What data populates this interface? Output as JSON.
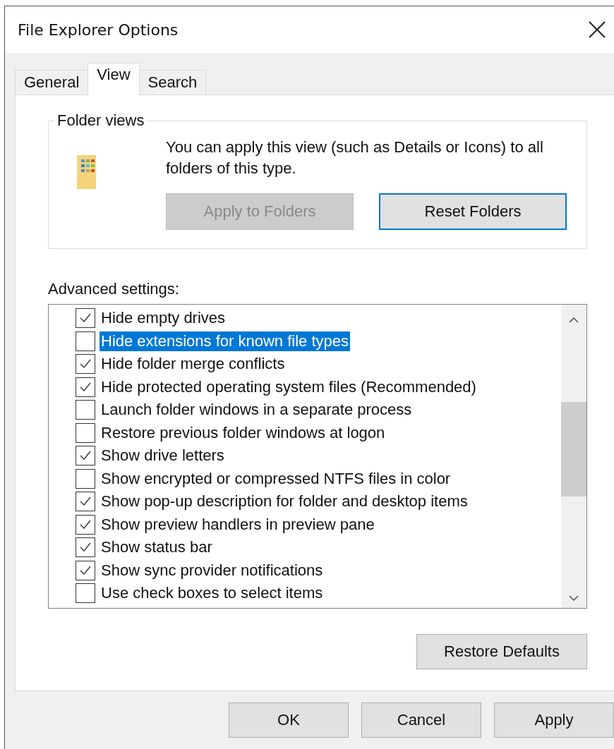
{
  "window": {
    "title": "File Explorer Options"
  },
  "tabs": [
    {
      "label": "General",
      "selected": false
    },
    {
      "label": "View",
      "selected": true
    },
    {
      "label": "Search",
      "selected": false
    }
  ],
  "folder_views": {
    "title": "Folder views",
    "description": "You can apply this view (such as Details or Icons) to all folders of this type.",
    "buttons": [
      {
        "label": "Apply to Folders",
        "disabled": true,
        "focused": false
      },
      {
        "label": "Reset Folders",
        "disabled": false,
        "focused": true
      }
    ]
  },
  "advanced_settings": {
    "label": "Advanced settings:",
    "items": [
      {
        "label": "Hide empty drives",
        "checked": true,
        "selected": false
      },
      {
        "label": "Hide extensions for known file types",
        "checked": false,
        "selected": true
      },
      {
        "label": "Hide folder merge conflicts",
        "checked": true,
        "selected": false
      },
      {
        "label": "Hide protected operating system files (Recommended)",
        "checked": true,
        "selected": false
      },
      {
        "label": "Launch folder windows in a separate process",
        "checked": false,
        "selected": false
      },
      {
        "label": "Restore previous folder windows at logon",
        "checked": false,
        "selected": false
      },
      {
        "label": "Show drive letters",
        "checked": true,
        "selected": false
      },
      {
        "label": "Show encrypted or compressed NTFS files in color",
        "checked": false,
        "selected": false
      },
      {
        "label": "Show pop-up description for folder and desktop items",
        "checked": true,
        "selected": false
      },
      {
        "label": "Show preview handlers in preview pane",
        "checked": true,
        "selected": false
      },
      {
        "label": "Show status bar",
        "checked": true,
        "selected": false
      },
      {
        "label": "Show sync provider notifications",
        "checked": true,
        "selected": false
      },
      {
        "label": "Use check boxes to select items",
        "checked": false,
        "selected": false
      }
    ],
    "restore_button": "Restore Defaults"
  },
  "buttons": [
    "OK",
    "Cancel",
    "Apply"
  ]
}
